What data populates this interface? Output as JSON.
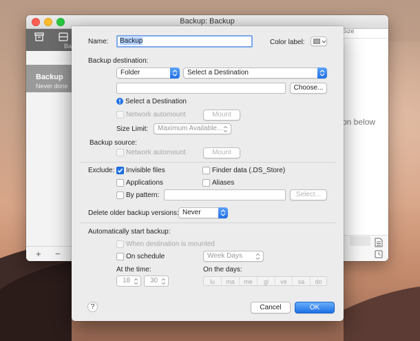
{
  "window": {
    "title": "Backup: Backup",
    "sidebar_section": "Ba",
    "column_header": "Size",
    "hint": "on below",
    "backup_item": {
      "name": "Backup",
      "status": "Never done"
    },
    "add_label": "+",
    "remove_label": "−"
  },
  "sheet": {
    "name_label": "Name:",
    "name_value": "Backup",
    "color_label": "Color label:",
    "destination": {
      "heading": "Backup destination:",
      "type": "Folder",
      "select_placeholder": "Select a Destination",
      "path_value": "",
      "choose_button": "Choose...",
      "info_text": "Select a Destination",
      "network_automount": "Network automount",
      "mount_button": "Mount",
      "size_limit_label": "Size Limit:",
      "size_limit_value": "Maximum Available..."
    },
    "source": {
      "heading": "Backup source:",
      "network_automount": "Network automount",
      "mount_button": "Mount"
    },
    "exclude": {
      "label": "Exclude:",
      "invisible_files": "Invisible files",
      "invisible_files_checked": true,
      "finder_data": "Finder data (.DS_Store)",
      "applications": "Applications",
      "aliases": "Aliases",
      "by_pattern": "By pattern:",
      "pattern_value": "",
      "select_button": "Select..."
    },
    "delete_older": {
      "label": "Delete older backup versions:",
      "value": "Never"
    },
    "auto": {
      "heading": "Automatically start backup:",
      "when_mounted": "When destination is mounted",
      "on_schedule": "On schedule",
      "frequency": "Week Days",
      "at_time_label": "At the time:",
      "hour": "18",
      "minute": "30",
      "on_days_label": "On the days:",
      "days": [
        "lu",
        "ma",
        "me",
        "gi",
        "ve",
        "sa",
        "do"
      ]
    },
    "help_label": "?",
    "cancel_button": "Cancel",
    "ok_button": "OK"
  },
  "colors": {
    "accent": "#1f72e8",
    "close": "#fd5f57",
    "minimize": "#febc2e",
    "maximize": "#28c840"
  }
}
